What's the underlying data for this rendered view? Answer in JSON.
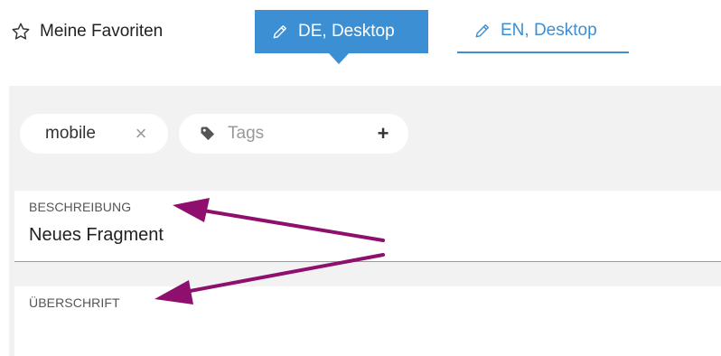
{
  "favorites": {
    "label": "Meine Favoriten",
    "icon": "star-outline-icon"
  },
  "tabs": [
    {
      "label": "DE, Desktop",
      "icon": "pencil-icon",
      "active": true
    },
    {
      "label": "EN, Desktop",
      "icon": "pencil-icon",
      "active": false
    }
  ],
  "tags": {
    "chips": [
      {
        "label": "mobile",
        "remove_symbol": "×"
      }
    ],
    "input_placeholder": "Tags",
    "add_symbol": "+",
    "icon": "tag-icon"
  },
  "fields": [
    {
      "label": "BESCHREIBUNG",
      "value": "Neues Fragment"
    },
    {
      "label": "ÜBERSCHRIFT",
      "value": ""
    }
  ],
  "colors": {
    "accent": "#3c8fd3",
    "annotation_arrow": "#8e0f6e",
    "background_gray": "#f2f2f2"
  }
}
